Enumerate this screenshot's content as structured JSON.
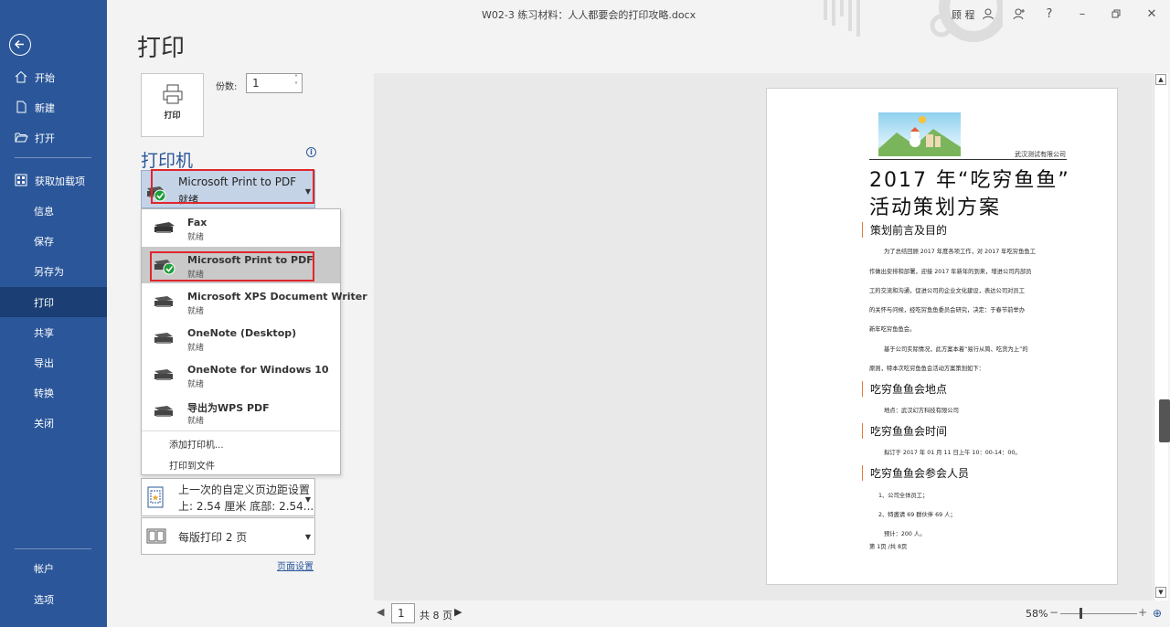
{
  "window": {
    "title": "W02-3 练习材料：人人都要会的打印攻略.docx",
    "user": "顾 程",
    "controls": [
      "user-icon",
      "share-person-icon",
      "help-icon",
      "minimize-icon",
      "restore-icon",
      "close-icon"
    ]
  },
  "sidebar": {
    "back_icon": "back-arrow-icon",
    "items": [
      {
        "label": "开始",
        "icon": "home-icon"
      },
      {
        "label": "新建",
        "icon": "new-doc-icon"
      },
      {
        "label": "打开",
        "icon": "folder-open-icon"
      },
      {
        "label": "获取加载项",
        "icon": "addins-grid-icon"
      },
      {
        "label": "信息"
      },
      {
        "label": "保存"
      },
      {
        "label": "另存为"
      },
      {
        "label": "打印",
        "active": true
      },
      {
        "label": "共享"
      },
      {
        "label": "导出"
      },
      {
        "label": "转换"
      },
      {
        "label": "关闭"
      }
    ],
    "bottom": [
      {
        "label": "帐户"
      },
      {
        "label": "选项"
      }
    ],
    "colors": {
      "bg": "#2b579a",
      "active": "#1b3f74"
    }
  },
  "print": {
    "title": "打印",
    "button_label": "打印",
    "copies_label": "份数:",
    "copies_value": "1",
    "printer_heading": "打印机",
    "selected_printer": {
      "name": "Microsoft Print to PDF",
      "status": "就绪"
    },
    "printers": [
      {
        "name": "Fax",
        "status": "就绪",
        "icon": "fax-icon"
      },
      {
        "name": "Microsoft Print to PDF",
        "status": "就绪",
        "icon": "printer-check-icon",
        "selected": true
      },
      {
        "name": "Microsoft XPS Document Writer",
        "status": "就绪",
        "icon": "printer-icon"
      },
      {
        "name": "OneNote (Desktop)",
        "status": "就绪",
        "icon": "printer-icon"
      },
      {
        "name": "OneNote for Windows 10",
        "status": "就绪",
        "icon": "printer-icon"
      },
      {
        "name": "导出为WPS PDF",
        "status": "就绪",
        "icon": "printer-icon"
      }
    ],
    "add_printer": "添加打印机...",
    "print_to_file": "打印到文件",
    "margins": {
      "line1": "上一次的自定义页边距设置",
      "line2": "上: 2.54 厘米 底部: 2.54..."
    },
    "pages_per_sheet": "每版打印 2 页",
    "page_setup": "页面设置",
    "highlight_color": "#e0262d"
  },
  "preview": {
    "company": "武汉测试有限公司",
    "title1": "2017 年“吃穷鱼鱼”",
    "title2": "活动策划方案",
    "h1": "策划前言及目的",
    "p1": [
      "为了总结回顾 2017 年度各项工作，对 2017 年吃穷鱼鱼工",
      "作做出安排和部署，迎接 2017 年新年的到来，增进公司内部员",
      "工的交流和沟通，促进公司的企业文化建设，表达公司对员工",
      "的关怀与问候，经吃穷鱼鱼委员会研究，决定：于春节前举办",
      "新年吃穷鱼鱼会。",
      "基于公司实际情况，此方案本着“易行从简、吃货为上”的",
      "原则，特本次吃穷鱼鱼会活动方案策划如下："
    ],
    "h2": "吃穷鱼鱼会地点",
    "p2": "地点：武汉幻方科技有限公司",
    "h3": "吃穷鱼鱼会时间",
    "p3": "拟订于 2017 年 01 月 11 日上午 10：00-14：00。",
    "h4": "吃穷鱼鱼会参会人员",
    "p4": [
      "1、公司全体员工；",
      "2、特邀请 69 群伙伴 69 人；",
      "预计：200 人。",
      "第 1页 /共 8页"
    ]
  },
  "footer": {
    "page_value": "1",
    "page_total": "共 8 页",
    "zoom": "58%",
    "zoom_level": 0.58
  }
}
